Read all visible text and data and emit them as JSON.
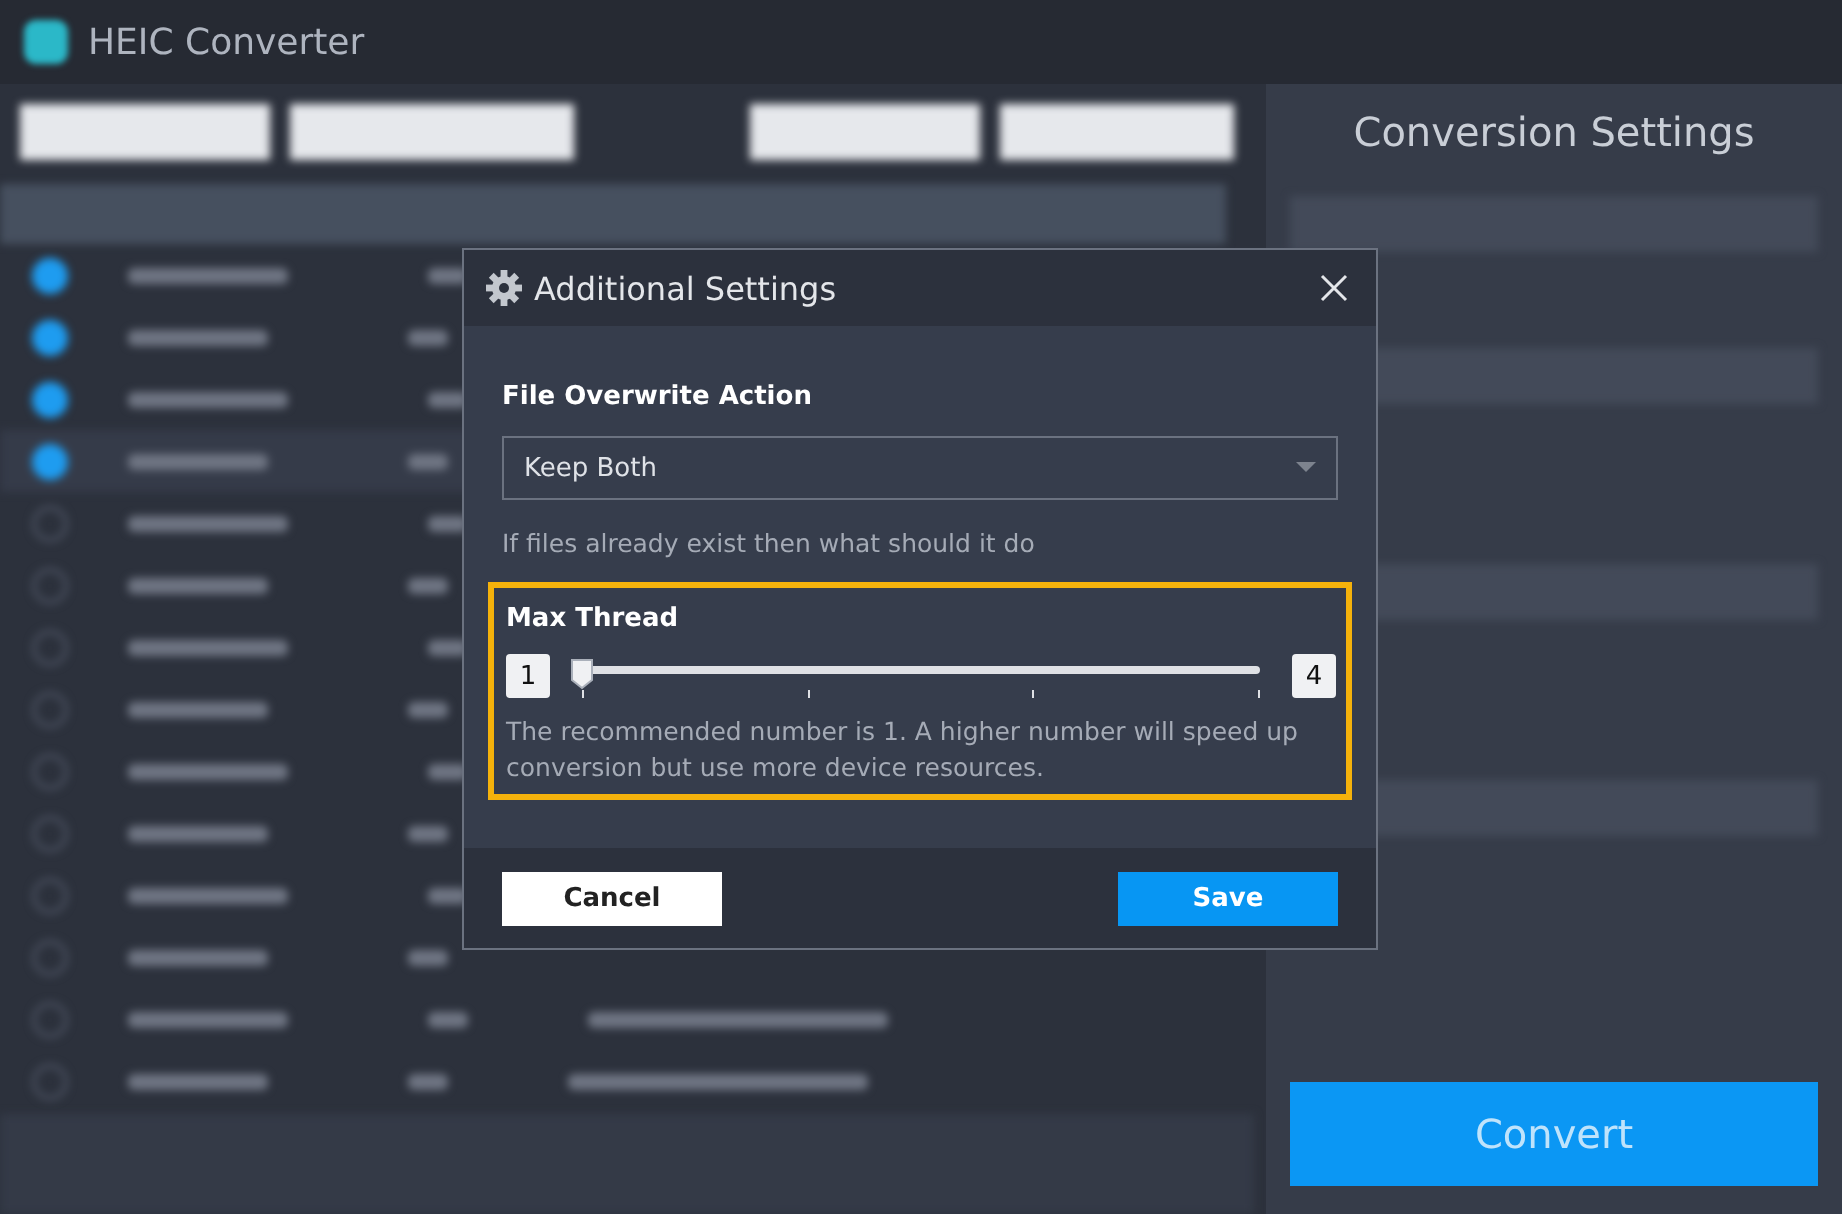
{
  "app": {
    "title": "HEIC Converter",
    "settings_title": "Conversion Settings",
    "convert_button": "Convert",
    "rows": [
      {
        "checked": true
      },
      {
        "checked": true
      },
      {
        "checked": true
      },
      {
        "checked": true
      },
      {
        "checked": false
      },
      {
        "checked": false
      },
      {
        "checked": false
      },
      {
        "checked": false
      },
      {
        "checked": false
      },
      {
        "checked": false
      },
      {
        "checked": false
      },
      {
        "checked": false
      },
      {
        "checked": false
      },
      {
        "checked": false
      }
    ]
  },
  "dialog": {
    "title": "Additional Settings",
    "overwrite": {
      "label": "File Overwrite Action",
      "value": "Keep Both",
      "hint": "If files already exist then what should it do"
    },
    "thread": {
      "label": "Max Thread",
      "min": "1",
      "max": "4",
      "level": 0,
      "highlighted": true,
      "note": "The recommended number is 1. A higher number will speed up conversion but use more device resources."
    },
    "buttons": [
      {
        "label": "Cancel",
        "kind": "secondary"
      },
      {
        "label": "Save",
        "kind": "primary"
      }
    ]
  }
}
